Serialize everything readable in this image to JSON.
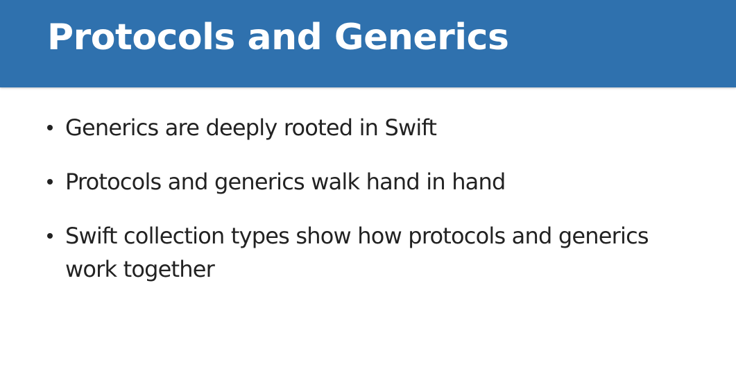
{
  "slide": {
    "title": "Protocols and Generics",
    "bullets": [
      "Generics are deeply rooted in Swift",
      "Protocols and generics walk hand in hand",
      "Swift collection types show how protocols and generics work together"
    ]
  },
  "colors": {
    "title_bar": "#2f71ae",
    "title_text": "#ffffff",
    "body_text": "#222222",
    "background": "#ffffff"
  }
}
